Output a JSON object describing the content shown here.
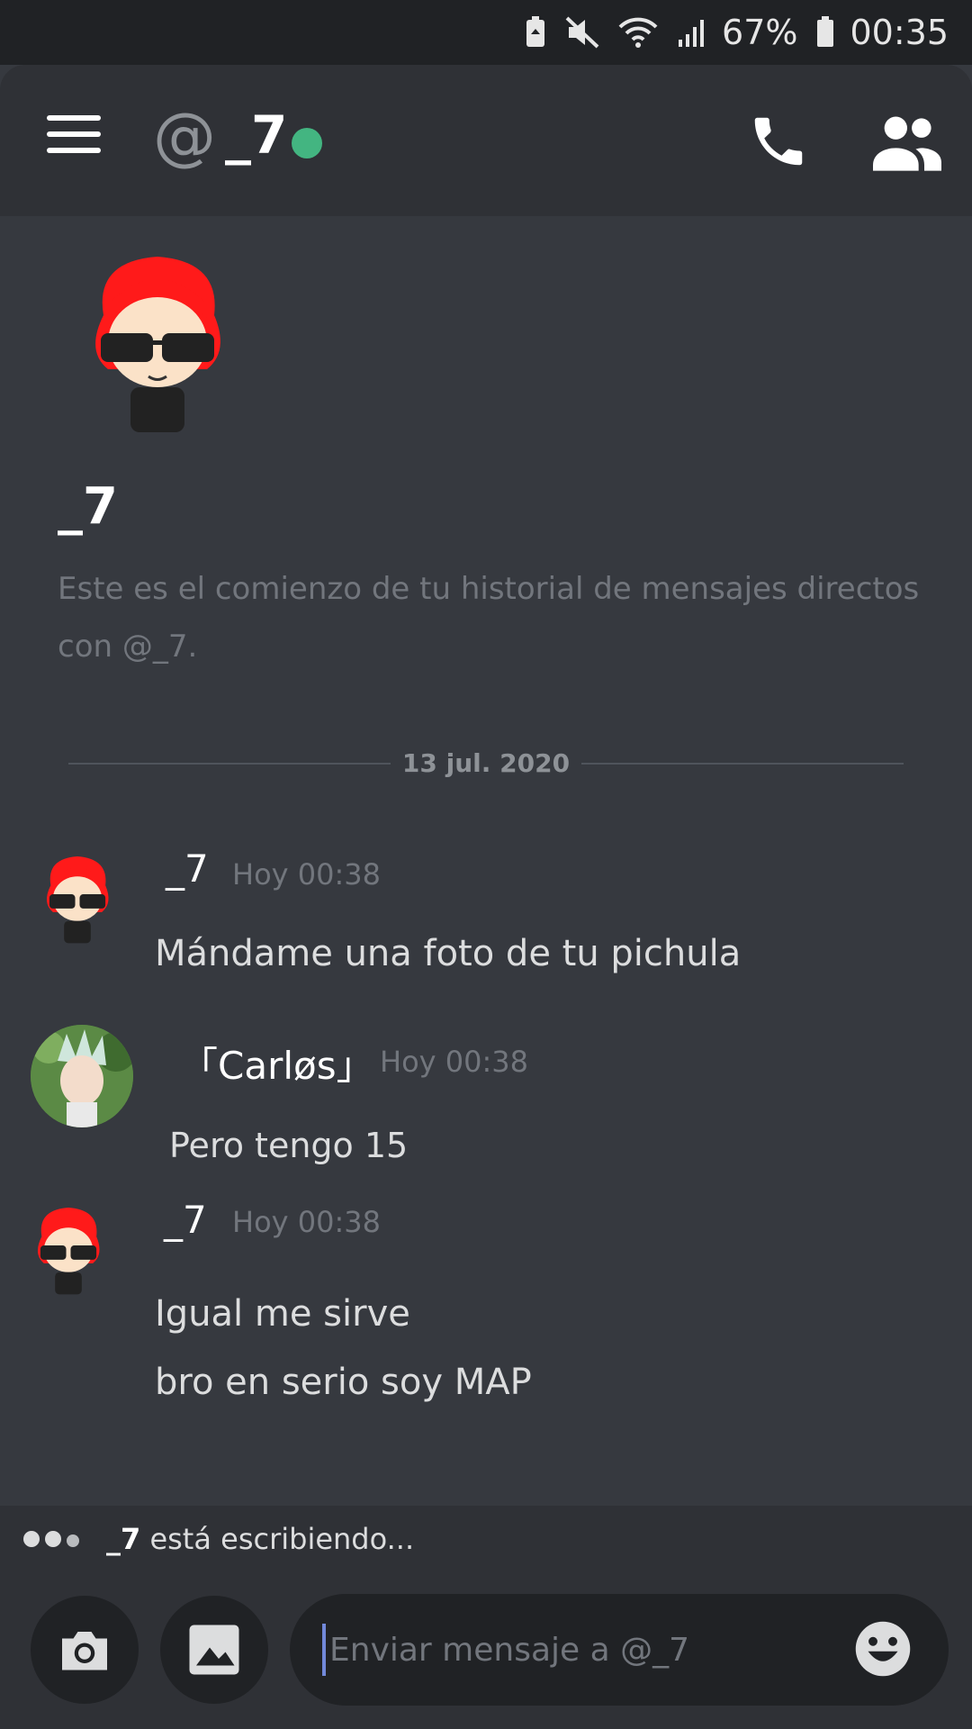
{
  "status_bar": {
    "battery": "67%",
    "time": "00:35"
  },
  "header": {
    "at_symbol": "@",
    "title": "_7",
    "status_color": "#43b581"
  },
  "welcome": {
    "name": "_7",
    "text": "Este es el comienzo de tu historial de mensajes directos con @_7."
  },
  "divider": {
    "date": "13 jul. 2020"
  },
  "messages": [
    {
      "author": "_7",
      "time": "Hoy 00:38",
      "lines": [
        "Mándame una foto de tu pichula"
      ]
    },
    {
      "author": "「Carløs」",
      "time": "Hoy 00:38",
      "lines": [
        "Pero tengo 15"
      ]
    },
    {
      "author": "_7",
      "time": "Hoy 00:38",
      "lines": [
        "Igual me sirve",
        "bro en serio soy MAP"
      ]
    }
  ],
  "typing": {
    "user": "_7",
    "text": " está escribiendo..."
  },
  "composer": {
    "placeholder": "Enviar mensaje a @_7"
  },
  "colors": {
    "background": "#36393f",
    "header": "#2f3136",
    "accent": "#7289da",
    "online": "#43b581"
  }
}
